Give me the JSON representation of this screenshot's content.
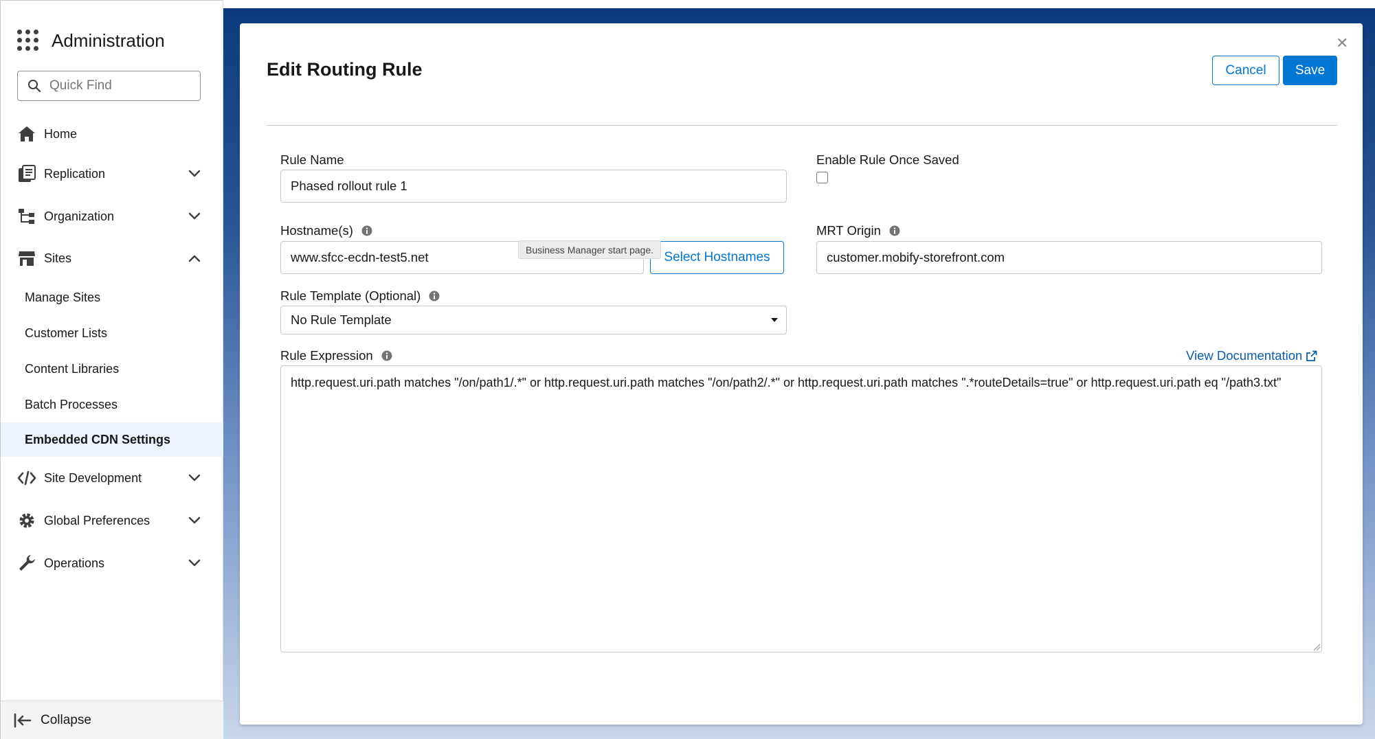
{
  "sidebar": {
    "app_title": "Administration",
    "quick_find_placeholder": "Quick Find",
    "nav": [
      {
        "label": "Home",
        "icon": "home-icon"
      },
      {
        "label": "Replication",
        "icon": "replication-icon",
        "expanded": false
      },
      {
        "label": "Organization",
        "icon": "organization-icon",
        "expanded": false
      },
      {
        "label": "Sites",
        "icon": "store-icon",
        "expanded": true
      },
      {
        "label": "Site Development",
        "icon": "code-icon",
        "expanded": false
      },
      {
        "label": "Global Preferences",
        "icon": "gear-icon",
        "expanded": false
      },
      {
        "label": "Operations",
        "icon": "wrench-icon",
        "expanded": false
      }
    ],
    "sites_children": [
      "Manage Sites",
      "Customer Lists",
      "Content Libraries",
      "Batch Processes",
      "Embedded CDN Settings"
    ],
    "active_child": "Embedded CDN Settings",
    "collapse_label": "Collapse"
  },
  "modal": {
    "title": "Edit Routing Rule",
    "cancel_label": "Cancel",
    "save_label": "Save",
    "rule_name_label": "Rule Name",
    "rule_name_value": "Phased rollout rule 1",
    "enable_label": "Enable Rule Once Saved",
    "enable_checked": false,
    "hostnames_label": "Hostname(s)",
    "hostnames_value": "www.sfcc-ecdn-test5.net",
    "tooltip_text": "Business Manager start page.",
    "select_hostnames_label": "Select Hostnames",
    "mrt_origin_label": "MRT Origin",
    "mrt_origin_value": "customer.mobify-storefront.com",
    "template_label": "Rule Template (Optional)",
    "template_value": "No Rule Template",
    "expression_label": "Rule Expression",
    "view_docs_label": "View Documentation",
    "expression_value": "http.request.uri.path matches \"/on/path1/.*\" or http.request.uri.path matches \"/on/path2/.*\" or http.request.uri.path matches \".*routeDetails=true\" or http.request.uri.path eq \"/path3.txt\""
  },
  "colors": {
    "brand": "#0176d3",
    "link": "#0b5cab",
    "active_bg": "#eef4ff",
    "backdrop_top": "#0b3a7e"
  }
}
